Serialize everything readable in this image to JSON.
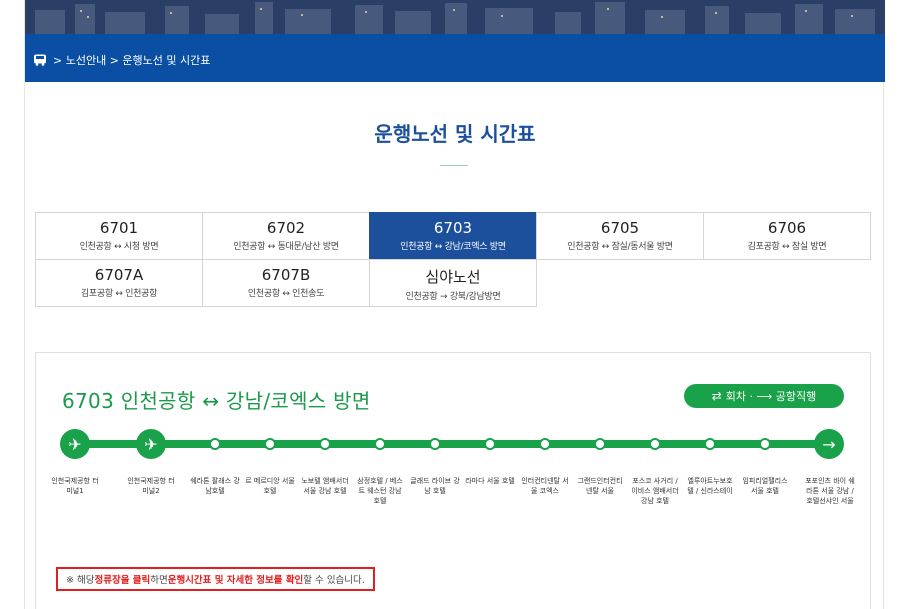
{
  "breadcrumb": {
    "text": "> 노선안내 > 운행노선 및 시간표"
  },
  "page": {
    "title": "운행노선 및 시간표"
  },
  "routes": [
    {
      "num": "6701",
      "desc": "인천공항 ↔ 시청 방면"
    },
    {
      "num": "6702",
      "desc": "인천공항 ↔ 동대문/남산 방면"
    },
    {
      "num": "6703",
      "desc": "인천공항 ↔ 강남/코엑스 방면",
      "active": true
    },
    {
      "num": "6705",
      "desc": "인천공항 ↔ 잠실/동서울 방면"
    },
    {
      "num": "6706",
      "desc": "김포공항 ↔ 잠실 방면"
    },
    {
      "num": "6707A",
      "desc": "김포공항 ↔ 인천공항"
    },
    {
      "num": "6707B",
      "desc": "인천공항 ↔ 인천송도"
    },
    {
      "num": "심야노선",
      "desc": "인천공항 → 강북/강남방면"
    }
  ],
  "panel": {
    "title": "6703 인천공항 ↔ 강남/코엑스 방면",
    "airport_btn": "회차 · ⟶ 공항직행"
  },
  "stops": [
    "인천국제공항 터미널1",
    "인천국제공항 터미널2",
    "쉐라톤 팔래스 강남호텔",
    "르 메르디앙 서울 호텔",
    "노보텔 앰배서더 서울 강남 호텔",
    "삼정호텔 / 베스트 웨스턴 강남 호텔",
    "글래드 라이브 강남 호텔",
    "라마다 서울 호텔",
    "인터컨티넨탈 서울 코엑스",
    "그랜드인터컨티넨탈 서울",
    "포스코 사거리 / 이비스 앰배서더 강남 호텔",
    "엘루아트누보호텔 / 신라스테이",
    "임피리얼팰리스 서울 호텔",
    "포포인츠 바이 쉐라톤 서울 강남 / 호텔선샤인 서울"
  ],
  "notice": {
    "p1": "※ 해당 ",
    "r1": "정류장을 클릭",
    "p2": "하면 ",
    "r2": "운행시간표 및 자세한 정보를 확인",
    "p3": "할 수 있습니다."
  },
  "colors": {
    "brand_blue": "#1c4f9c",
    "route_green": "#1aa24a",
    "notice_red": "#e02020"
  }
}
